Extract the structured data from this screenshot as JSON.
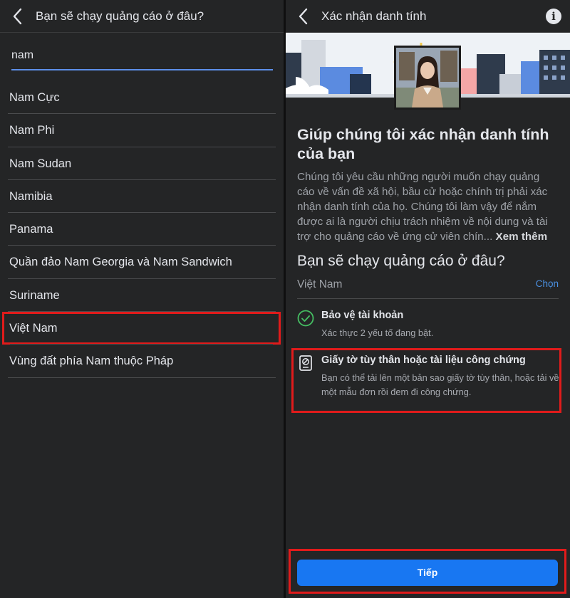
{
  "left": {
    "header": {
      "title": "Bạn sẽ chạy quảng cáo ở đâu?"
    },
    "search": {
      "value": "nam"
    },
    "countries": [
      {
        "label": "Nam Cực"
      },
      {
        "label": "Nam Phi"
      },
      {
        "label": "Nam Sudan"
      },
      {
        "label": "Namibia"
      },
      {
        "label": "Panama"
      },
      {
        "label": "Quần đảo Nam Georgia và Nam Sandwich"
      },
      {
        "label": "Suriname"
      },
      {
        "label": "Việt Nam",
        "selected": true
      },
      {
        "label": "Vùng đất phía Nam thuộc Pháp"
      }
    ]
  },
  "right": {
    "header": {
      "title": "Xác nhận danh tính",
      "info_icon": "i"
    },
    "title": "Giúp chúng tôi xác nhận danh tính của bạn",
    "description": "Chúng tôi yêu cầu những người muốn chạy quảng cáo về vấn đề xã hội, bầu cử hoặc chính trị phải xác nhận danh tính của họ. Chúng tôi làm vậy để nắm được ai là người chịu trách nhiệm về nội dung và tài trợ cho quảng cáo về ứng cử viên chín...",
    "see_more": "Xem thêm",
    "question": "Bạn sẽ chạy quảng cáo ở đâu?",
    "country": {
      "value": "Việt Nam",
      "choose_label": "Chọn"
    },
    "requirements": [
      {
        "icon": "check-circle-icon",
        "title": "Bảo vệ tài khoản",
        "subtitle": "Xác thực 2 yếu tố đang bật."
      },
      {
        "icon": "id-document-icon",
        "title": "Giấy tờ tùy thân hoặc tài liệu công chứng",
        "subtitle": "Bạn có thể tải lên một bản sao giấy tờ tùy thân, hoặc tải về một mẫu đơn rồi đem đi công chứng."
      }
    ],
    "next_label": "Tiếp"
  },
  "colors": {
    "background": "#242526",
    "accent": "#1877f2",
    "link": "#4a90e2",
    "highlight": "#e11b1b",
    "success": "#45bd62"
  }
}
